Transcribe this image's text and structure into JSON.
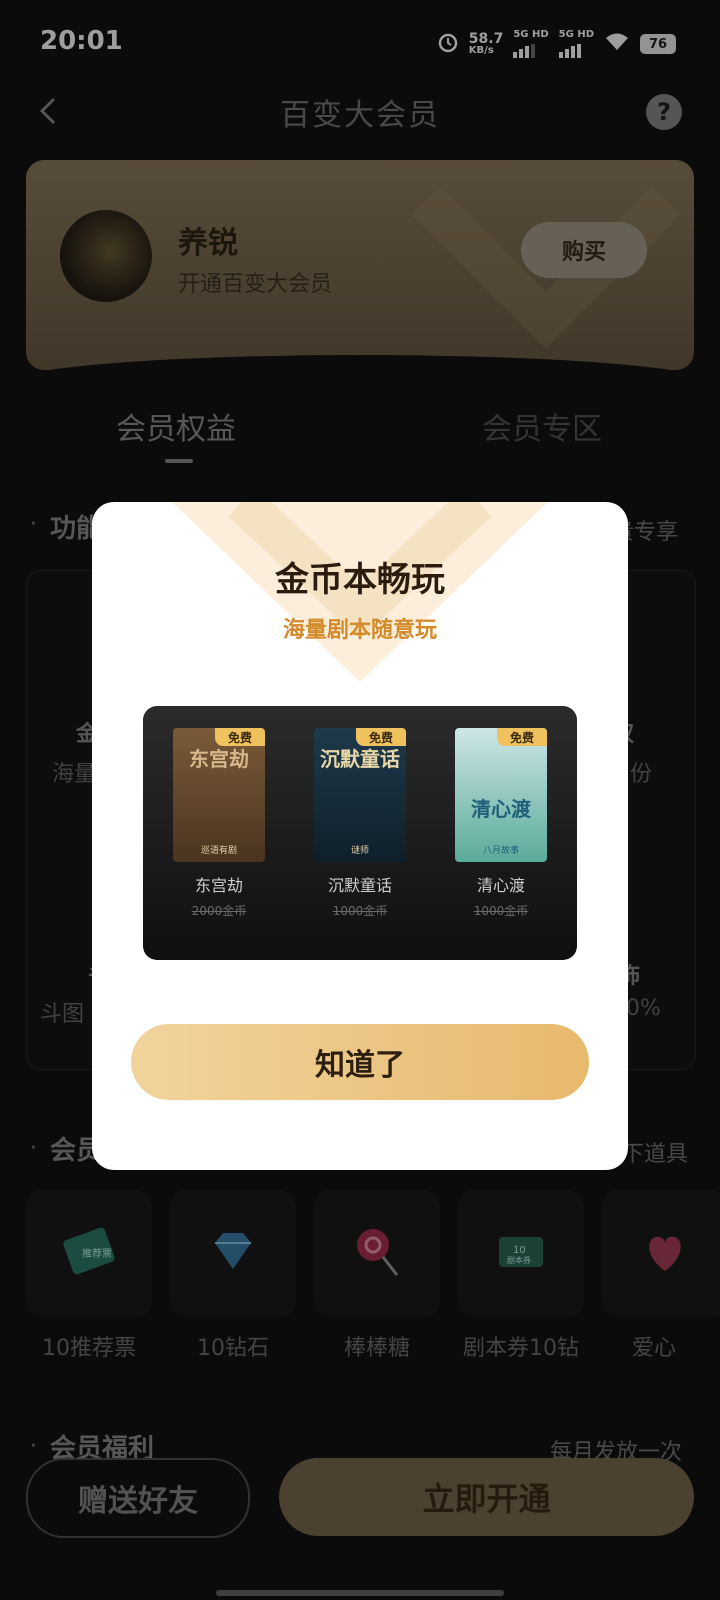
{
  "status_bar": {
    "time": "20:01",
    "net_speed": "58.7",
    "net_unit": "KB/s",
    "sim1": "5G HD",
    "sim2": "5G HD",
    "battery": "76"
  },
  "header": {
    "title": "百变大会员",
    "help": "?"
  },
  "member_card": {
    "name": "养锐",
    "subtitle": "开通百变大会员",
    "buy_label": "购买"
  },
  "tabs": [
    {
      "label": "会员权益"
    },
    {
      "label": "会员专区"
    }
  ],
  "section_features": {
    "title": "功能",
    "right_text": "贵专享",
    "row1_left_title": "金",
    "row1_left_sub": "海量",
    "row1_right_title": "权",
    "row1_right_sub": "份",
    "row2_left_title": "书",
    "row2_left_sub": "斗图",
    "row2_right_title": "饰",
    "row2_right_sub": "0%"
  },
  "section_props": {
    "title": "会员",
    "right_text": "下道具",
    "items": [
      {
        "label": "10推荐票",
        "icon": "ticket-icon"
      },
      {
        "label": "10钻石",
        "icon": "diamond-icon"
      },
      {
        "label": "棒棒糖",
        "icon": "lollipop-icon"
      },
      {
        "label": "剧本券10钻",
        "icon": "script-ticket-icon"
      },
      {
        "label": "爱心",
        "icon": "heart-icon"
      }
    ]
  },
  "section_welfare": {
    "title": "会员福利",
    "right_text": "每月发放一次"
  },
  "bottom_bar": {
    "gift_label": "赠送好友",
    "open_label": "立即开通"
  },
  "modal": {
    "title": "金币本畅玩",
    "subtitle": "海量剧本随意玩",
    "confirm_label": "知道了",
    "scripts": [
      {
        "name": "东宫劫",
        "price": "2000金币",
        "badge": "免费",
        "cover_title": "东宫劫",
        "cover_tag": "巡语有剧"
      },
      {
        "name": "沉默童话",
        "price": "1000金币",
        "badge": "免费",
        "cover_title": "沉默童话",
        "cover_tag": "谜师"
      },
      {
        "name": "清心渡",
        "price": "1000金币",
        "badge": "免费",
        "cover_title": "清心渡",
        "cover_tag": "八月故事"
      }
    ]
  },
  "colors": {
    "accent_gold": "#e7b96d",
    "modal_sub": "#d58a2a",
    "dark_bg": "#121212"
  }
}
